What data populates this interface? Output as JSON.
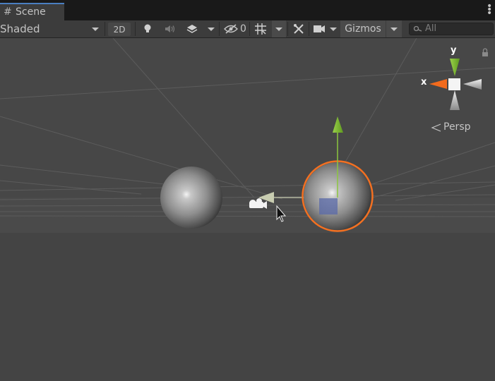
{
  "tab": {
    "title": "Scene",
    "hash_icon": "hash-icon"
  },
  "toolbar": {
    "shading_mode": "Shaded",
    "mode_2d": "2D",
    "hidden_count": "0",
    "gizmos_label": "Gizmos",
    "search_placeholder": "All"
  },
  "gizmo": {
    "y_label": "y",
    "x_label": "x",
    "projection": "Persp"
  },
  "colors": {
    "selection_outline": "#f37021",
    "y_axis": "#8cc63f",
    "x_axis": "#f26b1d",
    "tab_highlight": "#4a7fc1"
  }
}
